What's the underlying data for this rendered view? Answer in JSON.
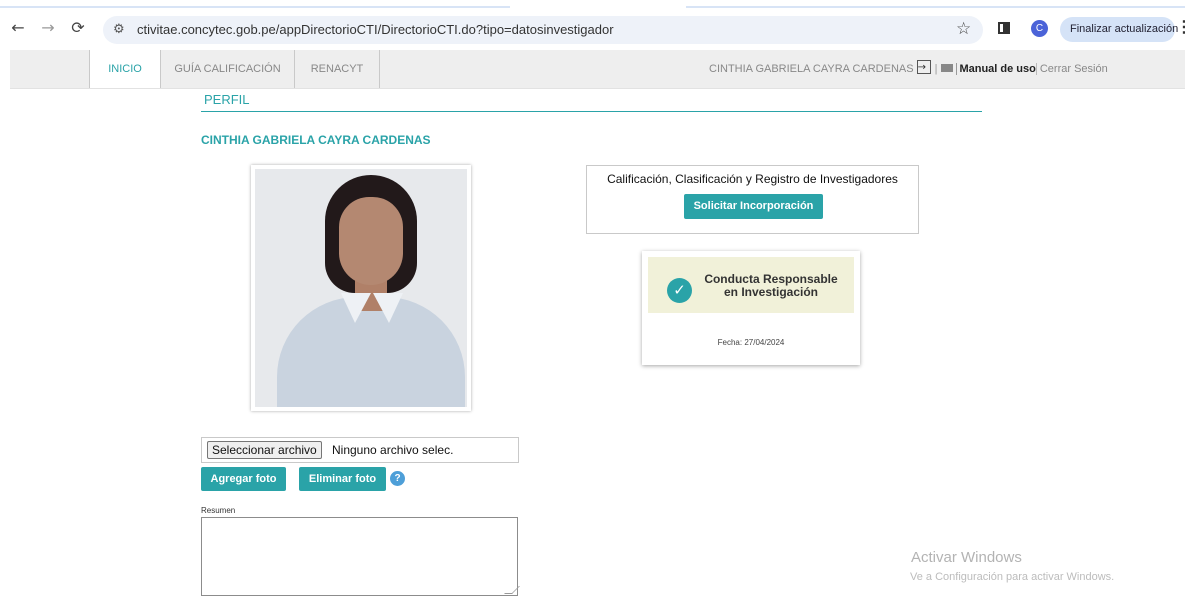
{
  "browser": {
    "url": "ctivitae.concytec.gob.pe/appDirectorioCTI/DirectorioCTI.do?tipo=datosinvestigador",
    "avatar_letter": "C",
    "update_label": "Finalizar actualización"
  },
  "nav": {
    "tabs": [
      {
        "label": "INICIO",
        "active": true
      },
      {
        "label": "GUÍA CALIFICACIÓN",
        "active": false
      },
      {
        "label": "RENACYT",
        "active": false
      }
    ],
    "user_name": "CINTHIA GABRIELA CAYRA CARDENAS",
    "manual_label": "Manual de uso",
    "logout_label": "Cerrar Sesión"
  },
  "profile": {
    "section_title": "PERFIL",
    "full_name": "CINTHIA GABRIELA CAYRA CARDENAS",
    "calif_title": "Calificación, Clasificación y Registro de Investigadores",
    "calif_button": "Solicitar Incorporación",
    "crc_title_line1": "Conducta Responsable",
    "crc_title_line2": "en Investigación",
    "crc_date": "Fecha: 27/04/2024",
    "file_button": "Seleccionar archivo",
    "file_none": "Ninguno archivo selec.",
    "add_photo": "Agregar foto",
    "remove_photo": "Eliminar foto",
    "resumen_label": "Resumen"
  },
  "watermark": {
    "title": "Activar Windows",
    "subtitle": "Ve a Configuración para activar Windows."
  },
  "colors": {
    "accent": "#2aa3a8",
    "help": "#4e9fd8"
  }
}
